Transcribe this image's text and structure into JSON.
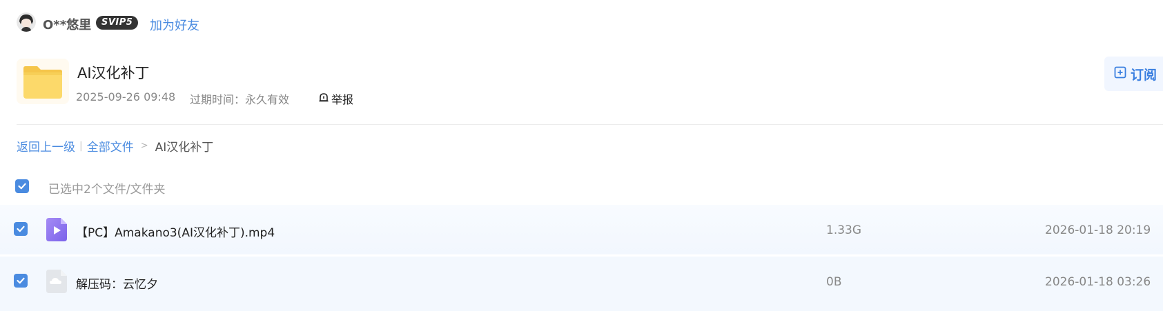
{
  "user": {
    "name": "O**悠里",
    "vip_badge": "SVIP5",
    "add_friend": "加为好友"
  },
  "folder": {
    "title": "AI汉化补丁",
    "date": "2025-09-26 09:48",
    "expire": "过期时间：永久有效",
    "report": "举报",
    "subscribe": "订阅"
  },
  "breadcrumb": {
    "back": "返回上一级",
    "all_files": "全部文件",
    "current": "AI汉化补丁"
  },
  "selection": {
    "text": "已选中2个文件/文件夹",
    "all_checked": true
  },
  "files": [
    {
      "name": "【PC】Amakano3(AI汉化补丁).mp4",
      "size": "1.33G",
      "date": "2026-01-18 20:19",
      "checked": true,
      "icon": "video-file-icon"
    },
    {
      "name": "解压码：云忆夕",
      "size": "0B",
      "date": "2026-01-18 03:26",
      "checked": true,
      "icon": "cloud-file-icon"
    }
  ]
}
